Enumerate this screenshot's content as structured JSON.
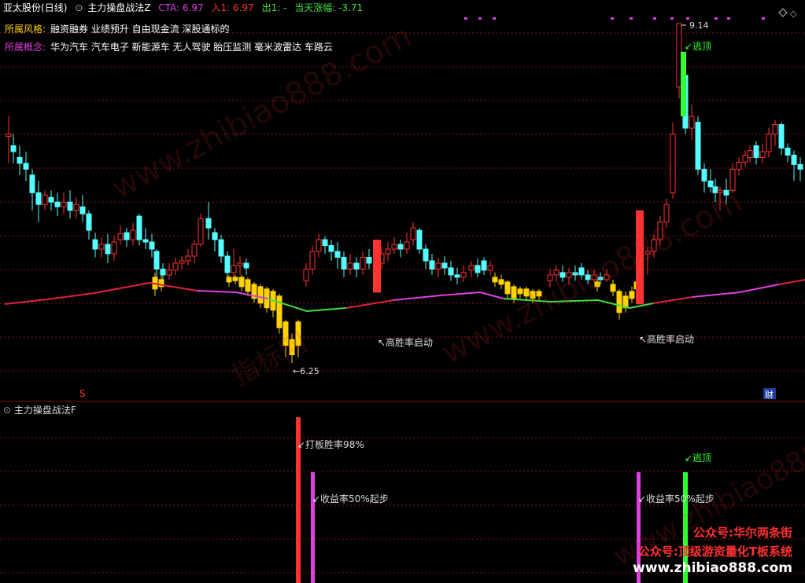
{
  "header": {
    "stock_name": "亚太股份",
    "period": "(日线)",
    "indicator_name": "主力操盘战法Z",
    "cta": "CTA: 6.97",
    "entry": "入1: 6.97",
    "exit": "出1: -",
    "change": "当天涨幅: -3.71"
  },
  "info": {
    "style_label": "所属风格:",
    "style_value": "融资融券 业绩预升 自由现金流 深股通标的",
    "concept_label": "所属概念:",
    "concept_value": "华为汽车 汽车电子 新能源车 无人驾驶 胎压监测 毫米波雷达 车路云"
  },
  "annotations": {
    "high_price": "9.14",
    "low_price": "6.25",
    "escape_top": "逃顶",
    "start_signal": "高胜率启动",
    "marker_s": "S",
    "marker_cai": "财"
  },
  "sub_panel": {
    "title": "主力操盘战法F",
    "signal_win_rate": "打板胜率98%",
    "signal_return": "收益率50%起步",
    "signal_escape": "逃顶"
  },
  "watermark": {
    "text_a": "www.zhibiao888.com",
    "text_b": "指标网"
  },
  "promo": {
    "line1": "公众号:华尔两条街",
    "line2": "公众号:顶级游资量化T板系统",
    "url": "www.zhibiao888.com"
  },
  "colors": {
    "up": "#ff3232",
    "down": "#54ffff",
    "yellow": "#ffd200",
    "ma_red": "#e02040",
    "ma_magenta": "#e040e0",
    "ma_green": "#40e040",
    "grid": "#8a1212",
    "magenta_bar": "#e040e0",
    "green_bar": "#30ff30"
  }
}
